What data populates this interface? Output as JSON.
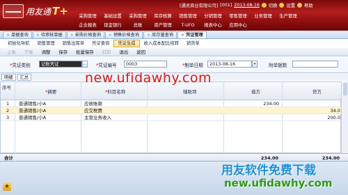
{
  "app": {
    "name": "用友通",
    "edition": "T+"
  },
  "status": {
    "account": "[通灵商业有限公司]",
    "company_code": "[001]",
    "date": "2013-08-16",
    "logout_label": "切换",
    "settings_label": "设置",
    "help_label": "帮助"
  },
  "menu_row1": [
    "采购管理",
    "基础设置",
    "采购管理",
    "库存核算",
    "销售管理",
    "分销管理",
    "零售管理",
    "业务管理",
    "生产管理"
  ],
  "menu_row2": [
    "企业报表",
    "现金银行",
    "总账",
    "资产管理",
    "T-UFO",
    "报表中心",
    "应用中心"
  ],
  "tabs": [
    {
      "label": "单据查询"
    },
    {
      "label": "待审核单据"
    },
    {
      "label": "采购价格查询"
    },
    {
      "label": "销售价格查询"
    },
    {
      "label": "库存量查询"
    },
    {
      "label": "凭证管理"
    }
  ],
  "toolbar1": [
    "初始化导航",
    "销售管理",
    "销售出库单",
    "凭证查询",
    "凭证生成",
    "收入成本配比结转",
    "销货单"
  ],
  "toolbar1_active_index": 4,
  "toolbar2": [
    "上张",
    "下张",
    "调整",
    "保存",
    "批量保存",
    "打印",
    "退出",
    "返回"
  ],
  "form": {
    "voucher_type_label": "凭证类别",
    "voucher_type_value": "记账凭证",
    "voucher_no_label": "凭证编号",
    "voucher_no_value": "0003",
    "date_label": "制单日期",
    "date_value": "2013-08-16",
    "attachments_label": "附单据数",
    "attachments_value": ""
  },
  "detail_tabs": [
    "明细",
    "汇总"
  ],
  "grid": {
    "headers": {
      "seq": "序号",
      "summary": "摘要",
      "account": "科目名称",
      "aux": "辅助项",
      "debit": "借方",
      "credit": "贷方"
    },
    "rows": [
      {
        "no": "1",
        "summary": "普通销售/小A",
        "account": "应收账款",
        "aux": "",
        "debit": "234.00",
        "credit": ""
      },
      {
        "no": "2",
        "summary": "普通销售/小A",
        "account": "应交税费",
        "aux": "",
        "debit": "",
        "credit": "34.0"
      },
      {
        "no": "3",
        "summary": "普通销售/小A",
        "account": "主营业务收入",
        "aux": "",
        "debit": "",
        "credit": "200.0"
      }
    ],
    "total_label": "合计",
    "total_debit": "234.00",
    "total_credit": "234.00"
  },
  "watermark": {
    "center": "new.ufidawhy.com",
    "brand": "用友软件免费下载",
    "url": "new.ufidawhy.com"
  }
}
